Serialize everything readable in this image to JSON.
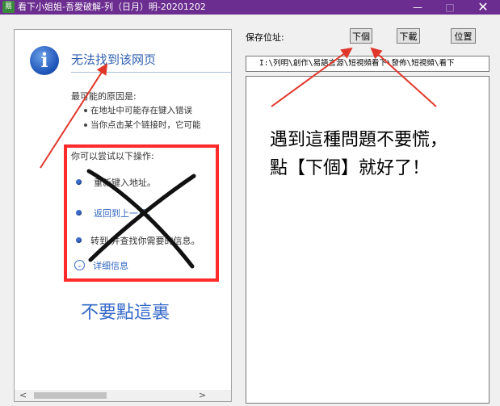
{
  "window": {
    "app_icon": "易",
    "title": "看下小姐姐-吾愛破解-列（日月）明-20201202",
    "minimize": "—",
    "maximize": "□",
    "close": "✕"
  },
  "browser": {
    "error_title": "无法找到该网页",
    "cause_heading": "最可能的原因是:",
    "causes": [
      "在地址中可能存在键入错误",
      "当你点击某个链接时，它可能"
    ],
    "try_heading": "你可以尝试以下操作:",
    "actions": [
      "重新键入地址。",
      "返回到上一页。",
      "转到  并查找你需要的信息。"
    ],
    "details": "详细信息",
    "details_icon": "⌄",
    "scroll_left": "<",
    "scroll_right": ">"
  },
  "annotations": {
    "dont_click": "不要點這裏",
    "message_line1": "遇到這種問題不要慌，",
    "message_line2": "點【下個】就好了！"
  },
  "controls": {
    "save_label": "保存位址:",
    "next_button": "下個",
    "download_button": "下載",
    "position_button": "位置",
    "save_path": "I:\\列明\\創作\\易語言源\\短視頻看下\\發佈\\短視頻\\看下"
  },
  "colors": {
    "titlebar": "#6b2d8f",
    "annotation_red": "#ff2a2a",
    "link_blue": "#2f66c0"
  }
}
